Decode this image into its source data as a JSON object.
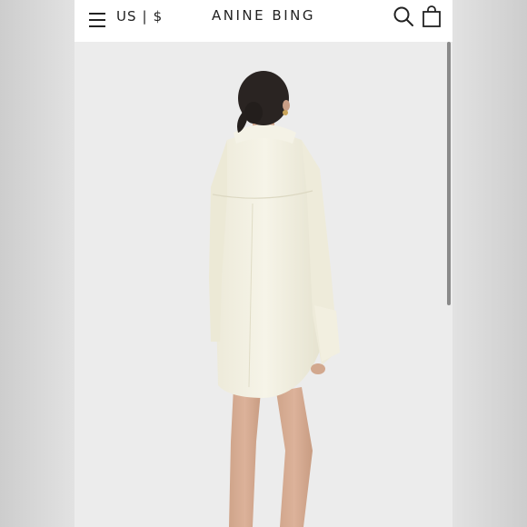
{
  "header": {
    "menu_icon": "hamburger-menu-icon",
    "locale": {
      "country": "US",
      "separator": "|",
      "currency": "$"
    },
    "brand": "ANINE BING",
    "search_icon": "search-icon",
    "bag_icon": "shopping-bag-icon"
  },
  "product": {
    "image_subject": "model-wearing-cream-oversized-shirt-back-view",
    "garment_color": "#f3f1e4",
    "background_color": "#ececec"
  }
}
